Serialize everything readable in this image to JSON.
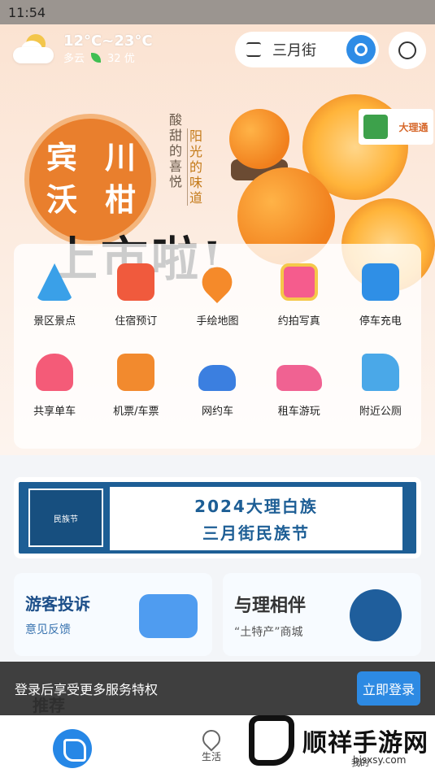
{
  "status_bar": {
    "time": "11:54"
  },
  "header": {
    "weather": {
      "temp": "12°C~23°C",
      "condition": "多云",
      "aqi": "32 优"
    },
    "search": {
      "placeholder": "三月街"
    }
  },
  "promo": {
    "title_chars": [
      "宾",
      "川",
      "沃",
      "柑"
    ],
    "vertical_1": "酸甜的喜悦",
    "vertical_2": "阳光的味道",
    "headline": "上市啦!",
    "logo_text": "大理通"
  },
  "services": [
    {
      "label": "景区景点",
      "icon": "mountain-icon",
      "color": "#3aa0e8"
    },
    {
      "label": "住宿预订",
      "icon": "hotel-icon",
      "color": "#f05a3d"
    },
    {
      "label": "手绘地图",
      "icon": "map-pin-icon",
      "color": "#f58a2a"
    },
    {
      "label": "约拍写真",
      "icon": "photo-icon",
      "color": "#f55c8d"
    },
    {
      "label": "停车充电",
      "icon": "ev-charger-icon",
      "color": "#2f8fe6"
    },
    {
      "label": "共享单车",
      "icon": "scooter-icon",
      "color": "#f45b78"
    },
    {
      "label": "机票/车票",
      "icon": "ticket-icon",
      "color": "#f28a2e"
    },
    {
      "label": "网约车",
      "icon": "car-icon",
      "color": "#3b7fe0"
    },
    {
      "label": "租车游玩",
      "icon": "convertible-icon",
      "color": "#f06292"
    },
    {
      "label": "附近公厕",
      "icon": "toilet-paper-icon",
      "color": "#4aa8e8"
    }
  ],
  "banner": {
    "emblem_text": "民族节",
    "line1": "2024大理白族",
    "line2": "三月街民族节"
  },
  "cards": {
    "complaint": {
      "title": "游客投诉",
      "subtitle": "意见反馈"
    },
    "mall": {
      "title": "与理相伴",
      "subtitle": "“土特产”商城"
    }
  },
  "login_bar": {
    "text": "登录后享受更多服务特权",
    "button": "立即登录"
  },
  "section": {
    "recommend": "推荐"
  },
  "tabbar": {
    "life": "生活",
    "mine": "我的"
  },
  "watermark": {
    "name": "顺祥手游网",
    "url": "bjsxsy.com"
  }
}
